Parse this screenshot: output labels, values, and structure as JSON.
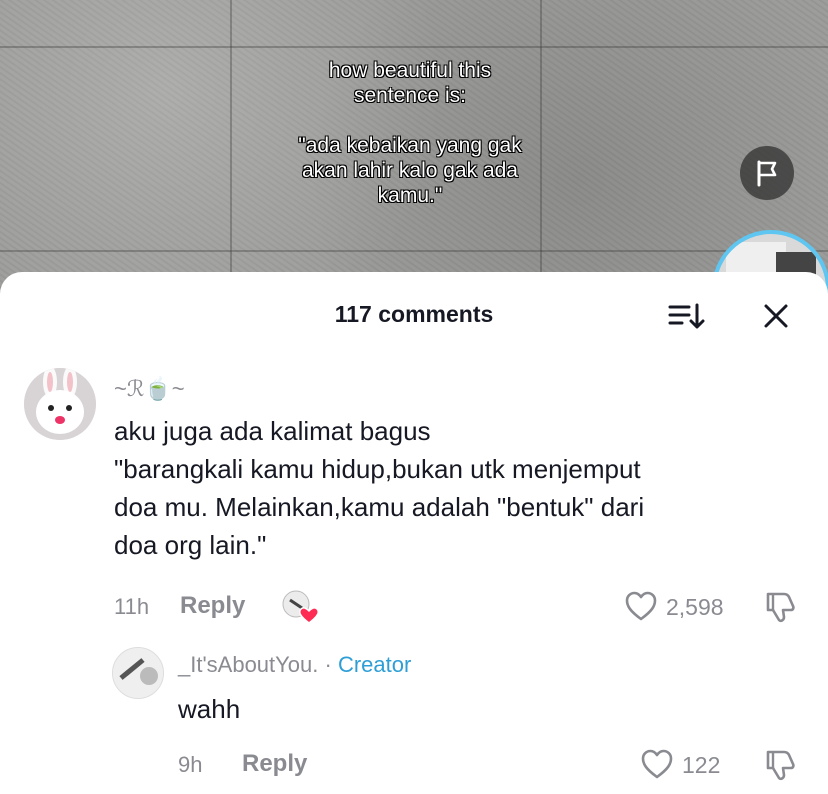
{
  "video": {
    "overlay_lines": [
      "how beautiful this",
      "sentence is:",
      "",
      "\"ada kebaikan yang gak",
      "akan lahir kalo gak ada",
      "kamu.\""
    ]
  },
  "comments_sheet": {
    "title": "117 comments"
  },
  "comments": [
    {
      "username": "~ℛ🍵~",
      "text": "aku juga ada kalimat bagus\n\"barangkali kamu hidup,bukan utk menjemput\ndoa mu. Melainkan,kamu adalah \"bentuk\" dari\ndoa org lain.\"",
      "time": "11h",
      "reply_label": "Reply",
      "like_count": "2,598"
    }
  ],
  "replies": [
    {
      "username": "_It'sAboutYou.",
      "separator": " · ",
      "badge": "Creator",
      "text": "wahh",
      "time": "9h",
      "reply_label": "Reply",
      "like_count": "122"
    }
  ],
  "colors": {
    "accent_creator": "#2e9fd6",
    "muted": "#8a8b91",
    "text": "#161823",
    "liked_heart": "#fe2c55"
  },
  "icons": [
    "flag-icon",
    "sort-icon",
    "close-icon",
    "heart-icon",
    "dislike-icon",
    "creator-liked-icon"
  ]
}
